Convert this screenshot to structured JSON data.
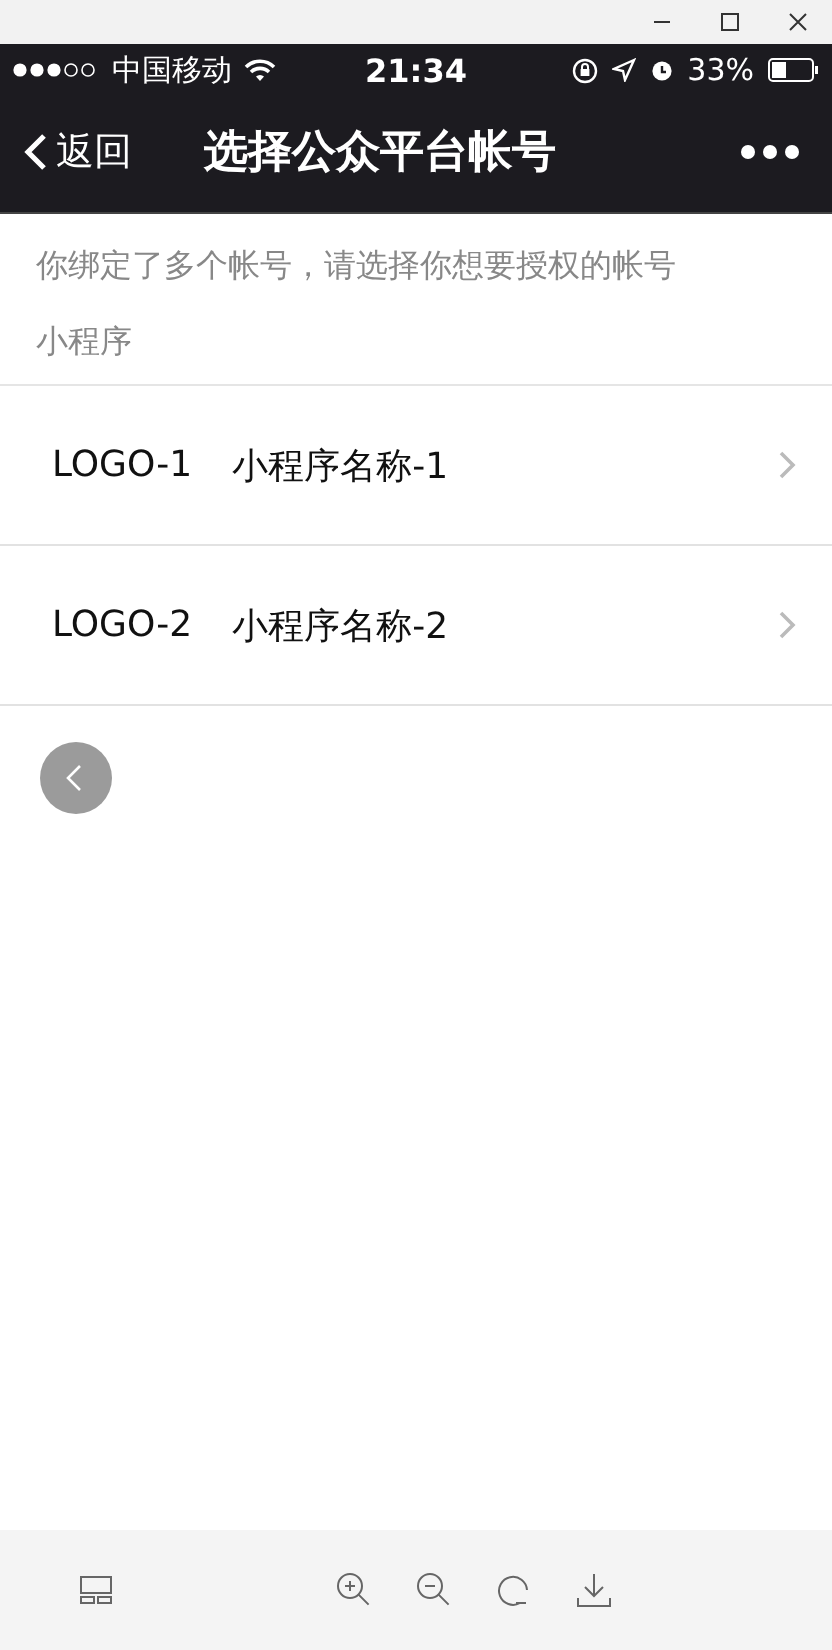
{
  "status_bar": {
    "carrier": "中国移动",
    "time": "21:34",
    "battery": "33%"
  },
  "nav_bar": {
    "back": "返回",
    "title": "选择公众平台帐号"
  },
  "intro": "你绑定了多个帐号，请选择你想要授权的帐号",
  "section": {
    "title": "小程序",
    "items": [
      {
        "logo": "LOGO-1",
        "name": "小程序名称-1"
      },
      {
        "logo": "LOGO-2",
        "name": "小程序名称-2"
      }
    ]
  }
}
